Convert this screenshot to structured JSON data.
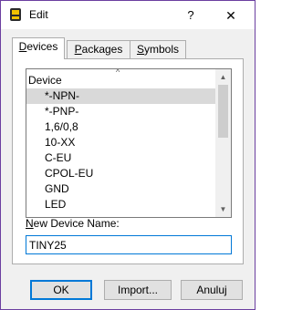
{
  "window": {
    "title": "Edit",
    "help_glyph": "?",
    "close_glyph": "✕"
  },
  "tabs": [
    {
      "label": "Devices",
      "mnemonic": "D"
    },
    {
      "label": "Packages",
      "mnemonic": "P"
    },
    {
      "label": "Symbols",
      "mnemonic": "S"
    }
  ],
  "device_list": {
    "header": "Device",
    "sort_glyph": "^",
    "items": [
      "*-NPN-",
      "*-PNP-",
      "1,6/0,8",
      "10-XX",
      "C-EU",
      "CPOL-EU",
      "GND",
      "LED"
    ],
    "selected": "*-NPN-"
  },
  "new_device": {
    "label": "New Device Name:",
    "mnemonic": "N",
    "value": "TINY25"
  },
  "buttons": {
    "ok": "OK",
    "import": "Import...",
    "cancel": "Anuluj"
  }
}
